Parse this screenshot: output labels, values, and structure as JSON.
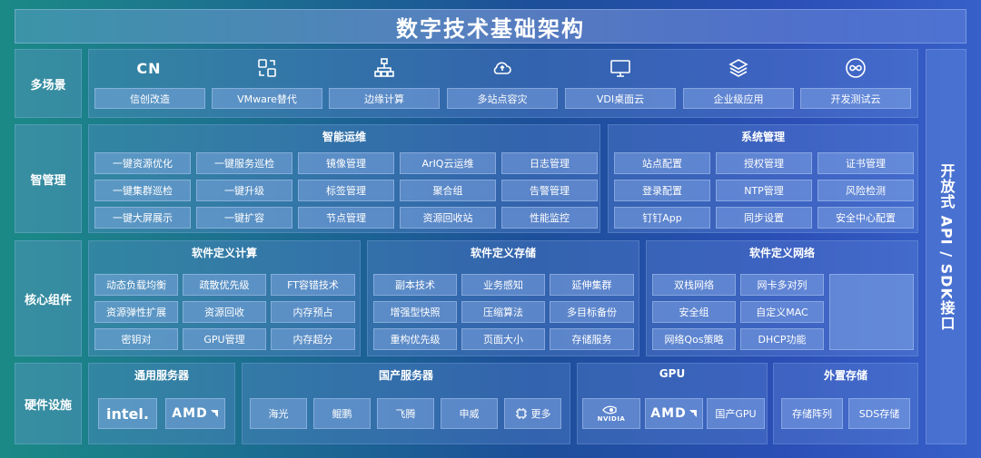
{
  "title": "数字技术基础架构",
  "right_panel": {
    "label": "开放式 API / SDK接口"
  },
  "rows": {
    "scenarios": {
      "label": "多场景"
    },
    "management": {
      "label": "智管理"
    },
    "core": {
      "label": "核心组件"
    },
    "hardware": {
      "label": "硬件设施"
    }
  },
  "scenarios": [
    {
      "icon": "cn-logo",
      "icon_text": "CN",
      "label": "信创改造"
    },
    {
      "icon": "swap-icon",
      "label": "VMware替代"
    },
    {
      "icon": "network-tree-icon",
      "label": "边缘计算"
    },
    {
      "icon": "cloud-sync-icon",
      "label": "多站点容灾"
    },
    {
      "icon": "monitor-icon",
      "label": "VDI桌面云"
    },
    {
      "icon": "layers-icon",
      "label": "企业级应用"
    },
    {
      "icon": "infinity-icon",
      "label": "开发测试云"
    }
  ],
  "management": {
    "smart_ops": {
      "title": "智能运维",
      "items": [
        [
          "一键资源优化",
          "一键服务巡检",
          "镜像管理",
          "ArIQ云运维",
          "日志管理"
        ],
        [
          "一键集群巡检",
          "一键升级",
          "标签管理",
          "聚合组",
          "告警管理"
        ],
        [
          "一键大屏展示",
          "一键扩容",
          "节点管理",
          "资源回收站",
          "性能监控"
        ]
      ]
    },
    "system": {
      "title": "系统管理",
      "items": [
        [
          "站点配置",
          "授权管理",
          "证书管理"
        ],
        [
          "登录配置",
          "NTP管理",
          "风险检测"
        ],
        [
          "钉钉App",
          "同步设置",
          "安全中心配置"
        ]
      ]
    }
  },
  "core": {
    "compute": {
      "title": "软件定义计算",
      "items": [
        [
          "动态负载均衡",
          "疏散优先级",
          "FT容错技术"
        ],
        [
          "资源弹性扩展",
          "资源回收",
          "内存预占"
        ],
        [
          "密钥对",
          "GPU管理",
          "内存超分"
        ]
      ]
    },
    "storage": {
      "title": "软件定义存储",
      "items": [
        [
          "副本技术",
          "业务感知",
          "延伸集群"
        ],
        [
          "增强型快照",
          "压缩算法",
          "多目标备份"
        ],
        [
          "重构优先级",
          "页面大小",
          "存储服务"
        ]
      ]
    },
    "network": {
      "title": "软件定义网络",
      "items": [
        [
          "双栈网络",
          "网卡多对列"
        ],
        [
          "安全组",
          "自定义MAC"
        ],
        [
          "网络Qos策略",
          "DHCP功能"
        ]
      ]
    }
  },
  "hardware": {
    "general": {
      "title": "通用服务器",
      "logos": [
        "intel.",
        "AMD"
      ]
    },
    "domestic": {
      "title": "国产服务器",
      "items": [
        "海光",
        "鲲鹏",
        "飞腾",
        "申威",
        "更多"
      ]
    },
    "gpu": {
      "title": "GPU",
      "items": [
        "NVIDIA",
        "AMD",
        "国产GPU"
      ]
    },
    "storage": {
      "title": "外置存储",
      "items": [
        "存储阵列",
        "SDS存储"
      ]
    }
  },
  "colors": {
    "accent": "#ffffff",
    "background_start": "#1b8a86",
    "background_end": "#3760c9"
  }
}
